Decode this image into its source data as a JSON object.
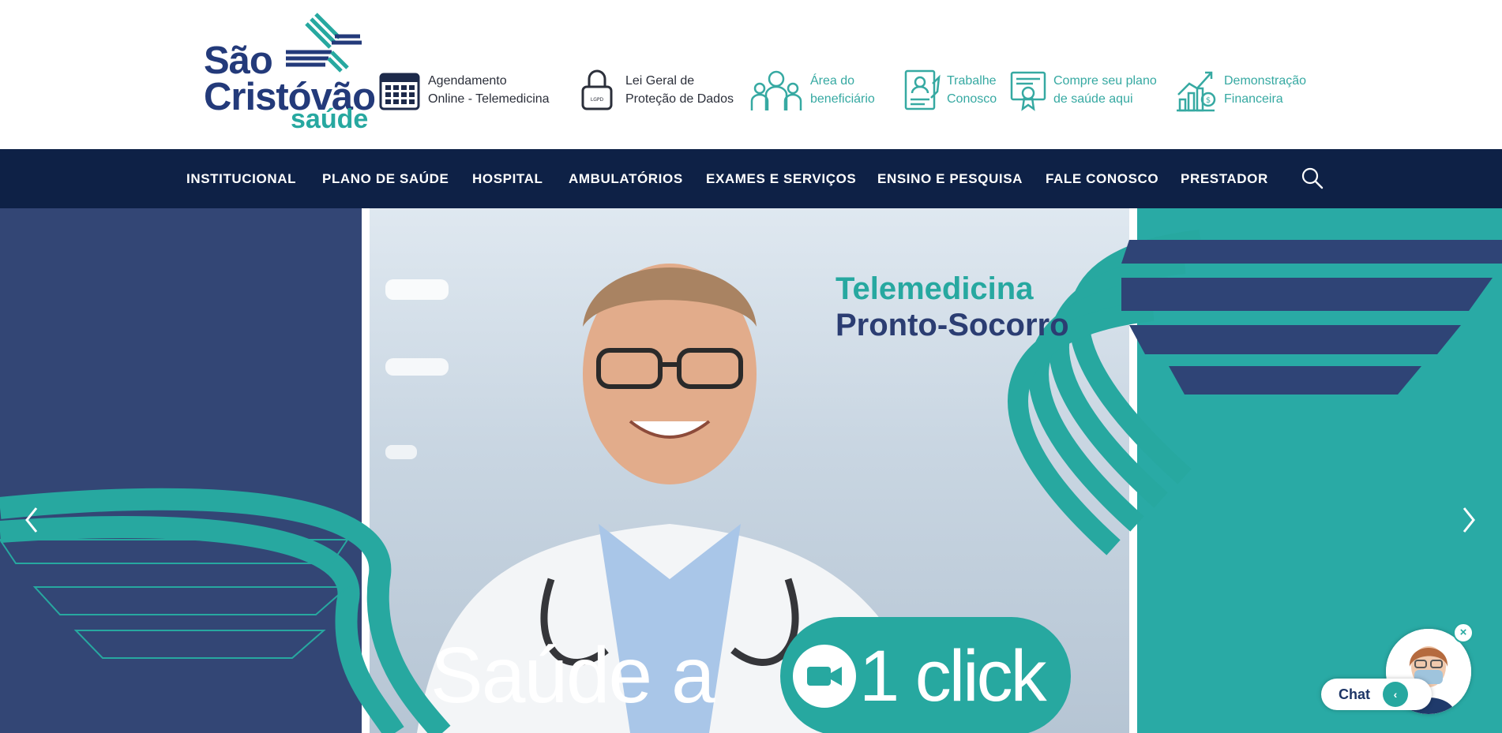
{
  "logo": {
    "line1": "São",
    "line2": "Cristóvão",
    "line3": "saúde"
  },
  "quick_links": [
    {
      "label": "Agendamento\nOnline - Telemedicina",
      "icon": "calendar-icon"
    },
    {
      "label": "Lei Geral de\nProteção de Dados",
      "icon": "padlock-icon"
    },
    {
      "label": "Área do\nbeneficiário",
      "icon": "family-icon"
    },
    {
      "label": "Trabalhe\nConosco",
      "icon": "resume-icon"
    },
    {
      "label": "Compre seu plano\nde saúde aqui",
      "icon": "certificate-icon"
    },
    {
      "label": "Demonstração\nFinanceira",
      "icon": "financial-chart-icon"
    }
  ],
  "nav": {
    "items": [
      "INSTITUCIONAL",
      "PLANO DE SAÚDE",
      "HOSPITAL",
      "AMBULATÓRIOS",
      "EXAMES E SERVIÇOS",
      "ENSINO E PESQUISA",
      "FALE CONOSCO",
      "PRESTADOR"
    ],
    "search_icon": "search-icon"
  },
  "hero": {
    "title_line1": "Telemedicina",
    "title_line2": "Pronto-Socorro",
    "caption": "Saúde a",
    "cta": "1 click",
    "prev_icon": "chevron-left-icon",
    "next_icon": "chevron-right-icon"
  },
  "chat": {
    "label": "Chat",
    "close": "×",
    "toggle": "‹"
  },
  "colors": {
    "navy": "#0e2146",
    "brand_blue": "#233a7a",
    "teal": "#27a8a0",
    "hero_left": "#334675",
    "hero_right": "#29aaa5"
  }
}
